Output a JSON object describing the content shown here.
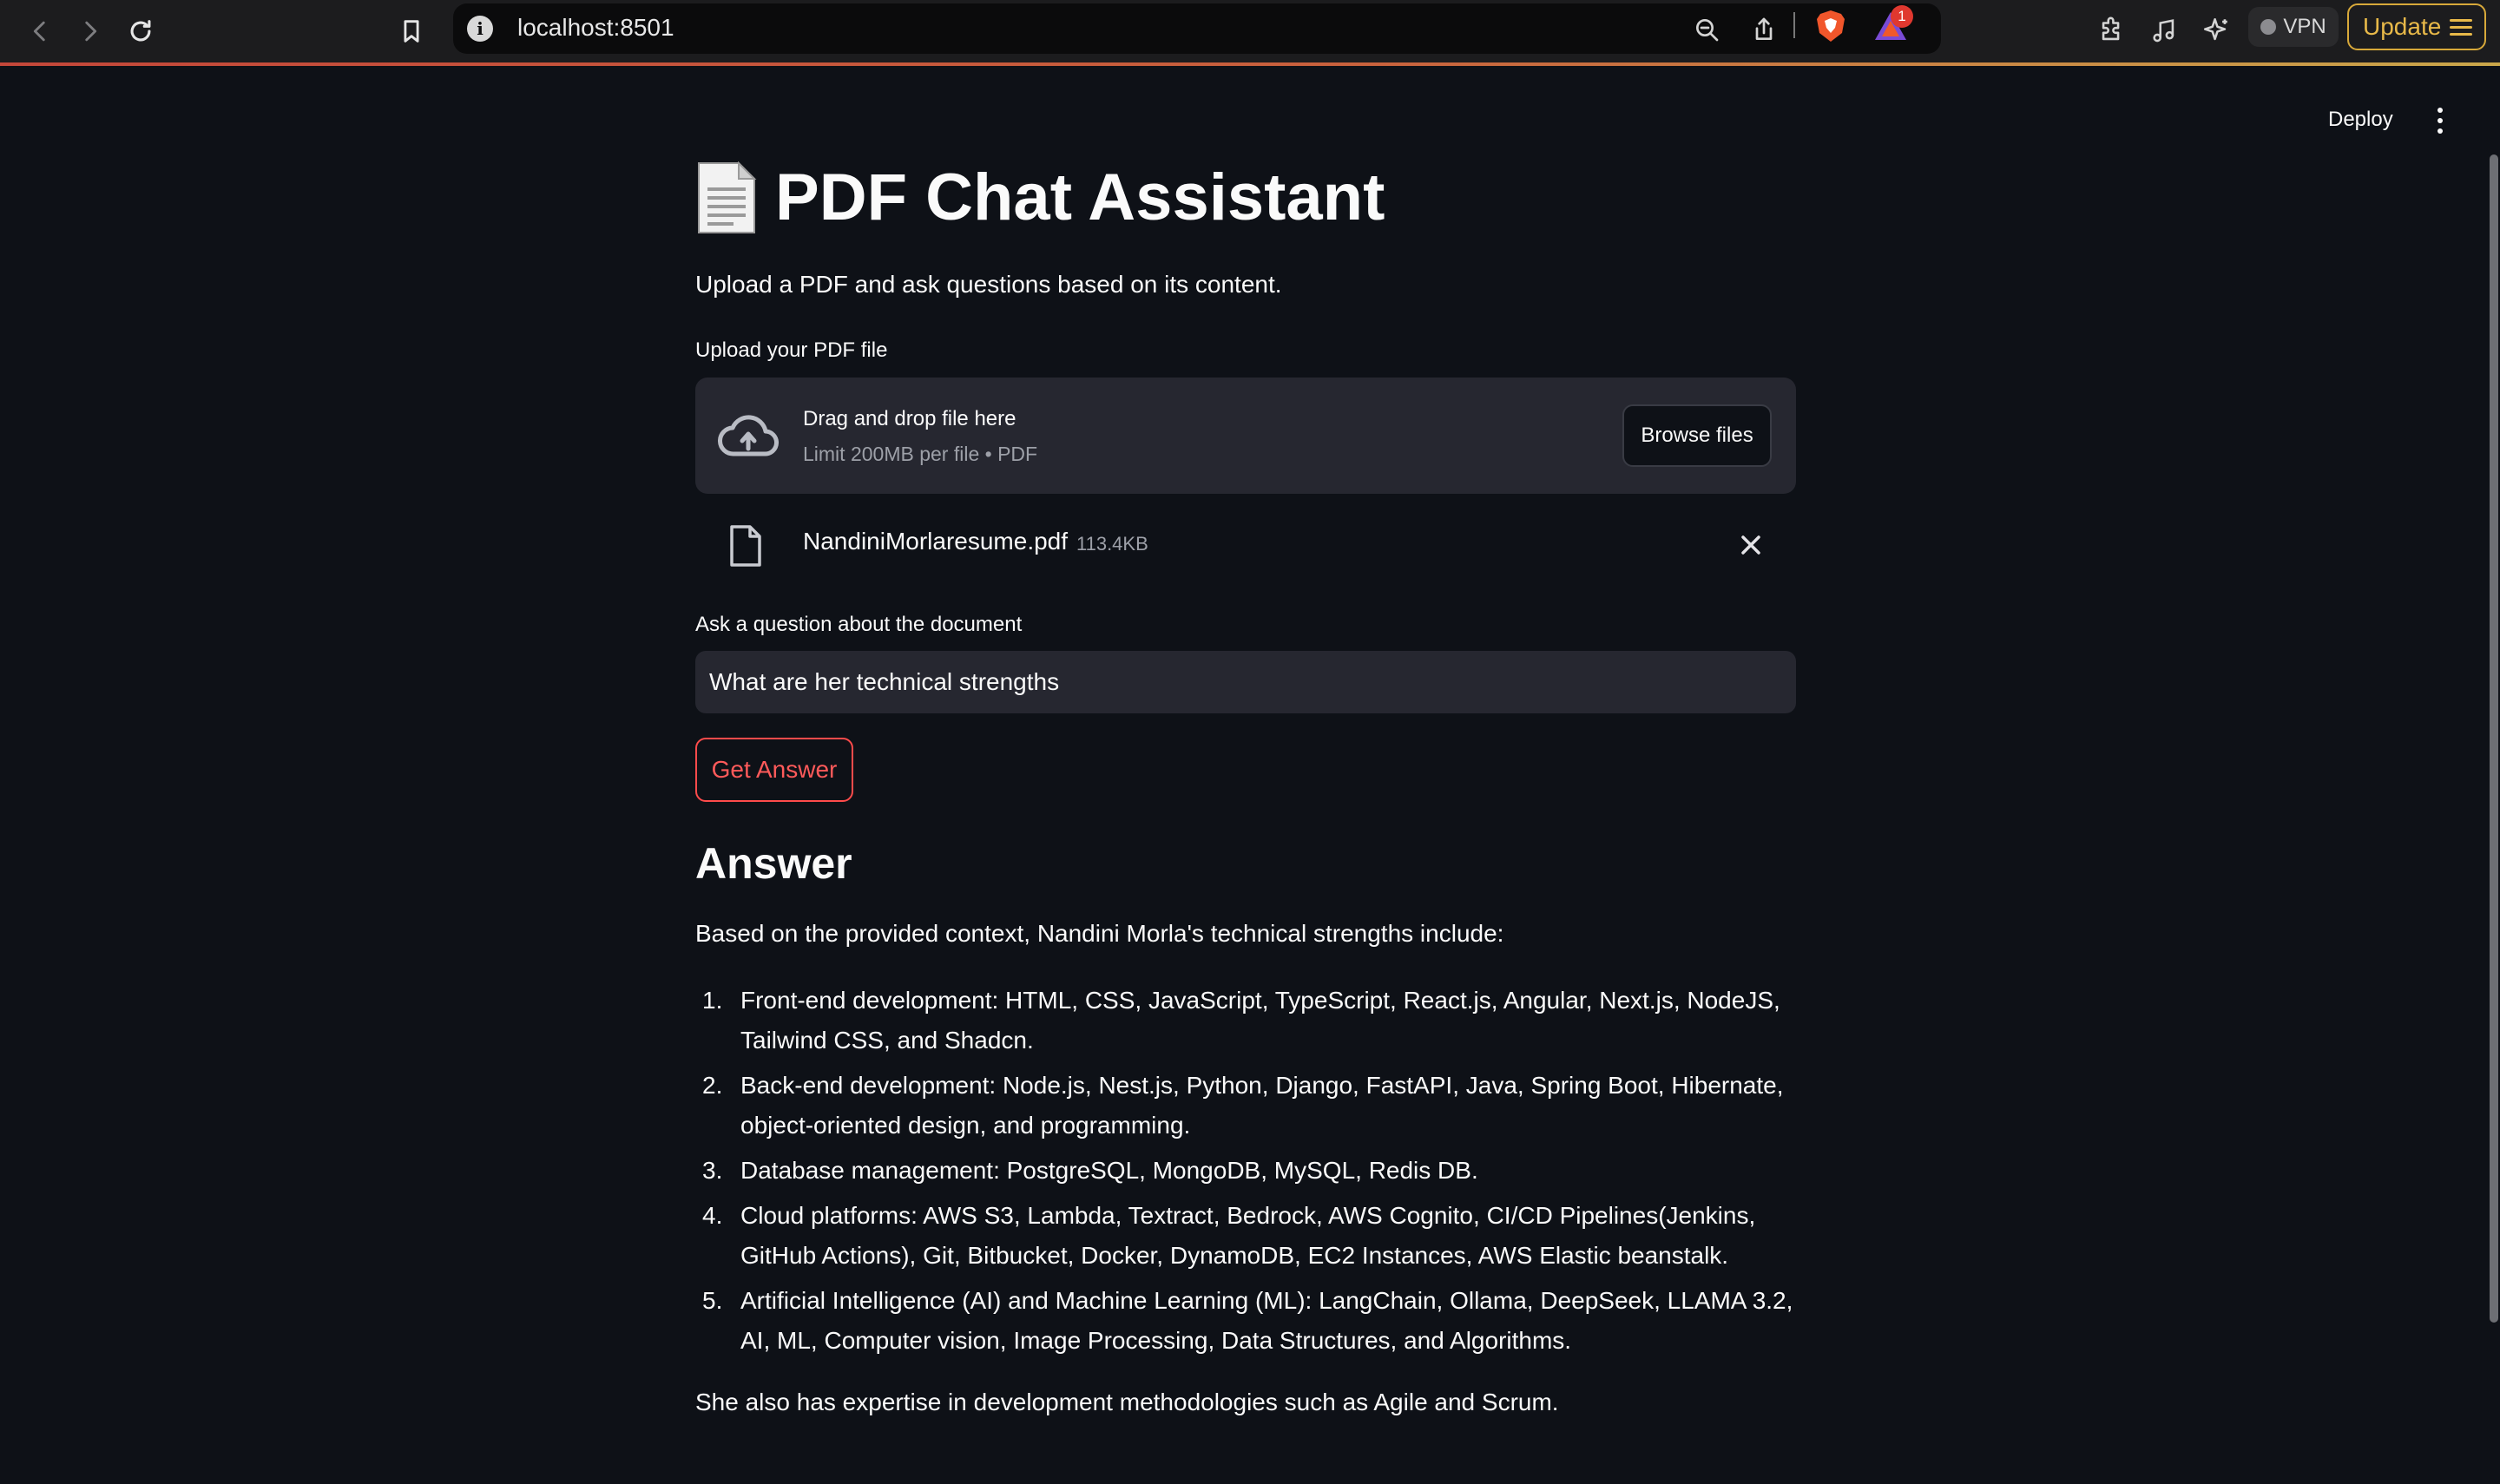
{
  "browser": {
    "url": "localhost:8501",
    "notification_count": "1",
    "vpn_label": "VPN",
    "update_label": "Update",
    "accent_color": "#e8b949"
  },
  "app_header": {
    "deploy_label": "Deploy"
  },
  "main": {
    "title_icon": "page-facing-up-emoji",
    "title": "PDF Chat Assistant",
    "subtitle": "Upload a PDF and ask questions based on its content.",
    "uploader": {
      "label": "Upload your PDF file",
      "drop_text": "Drag and drop file here",
      "limit_text": "Limit 200MB per file • PDF",
      "browse_label": "Browse files"
    },
    "uploaded_file": {
      "name": "NandiniMorlaresume.pdf",
      "size": "113.4KB"
    },
    "question": {
      "label": "Ask a question about the document",
      "value": "What are her technical strengths"
    },
    "submit_label": "Get Answer",
    "submit_color": "#ff4b4b",
    "answer": {
      "heading": "Answer",
      "intro": "Based on the provided context, Nandini Morla's technical strengths include:",
      "items": [
        {
          "num": "1.",
          "text": "Front-end development: HTML, CSS, JavaScript, TypeScript, React.js, Angular, Next.js, NodeJS, Tailwind CSS, and Shadcn."
        },
        {
          "num": "2.",
          "text": "Back-end development: Node.js, Nest.js, Python, Django, FastAPI, Java, Spring Boot, Hibernate, object-oriented design, and programming."
        },
        {
          "num": "3.",
          "text": "Database management: PostgreSQL, MongoDB, MySQL, Redis DB."
        },
        {
          "num": "4.",
          "text": "Cloud platforms: AWS S3, Lambda, Textract, Bedrock, AWS Cognito, CI/CD Pipelines(Jenkins, GitHub Actions), Git, Bitbucket, Docker, DynamoDB, EC2 Instances, AWS Elastic beanstalk."
        },
        {
          "num": "5.",
          "text": "Artificial Intelligence (AI) and Machine Learning (ML): LangChain, Ollama, DeepSeek, LLAMA 3.2, AI, ML, Computer vision, Image Processing, Data Structures, and Algorithms."
        }
      ],
      "outro": "She also has expertise in development methodologies such as Agile and Scrum."
    }
  }
}
